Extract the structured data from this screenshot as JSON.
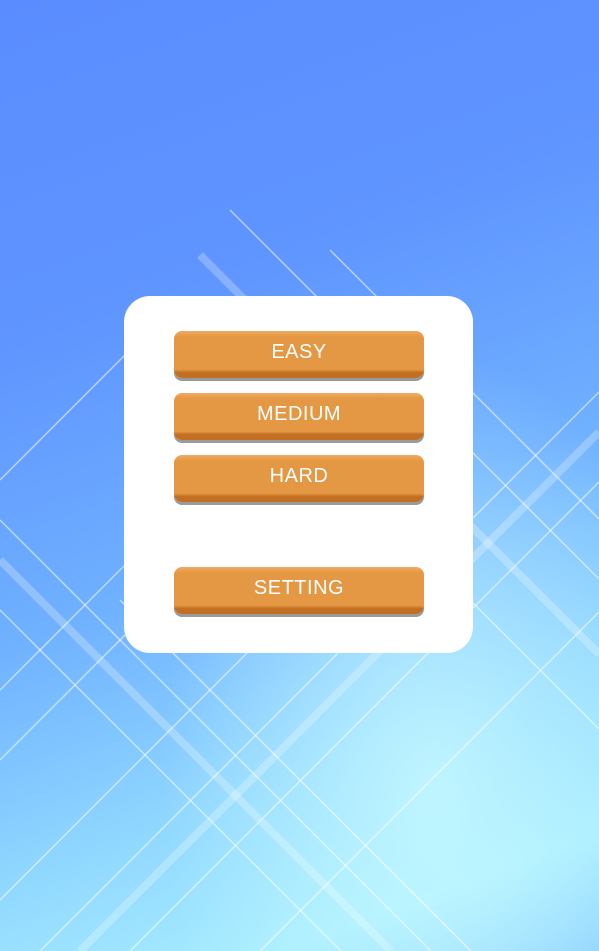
{
  "menu": {
    "easy_label": "EASY",
    "medium_label": "MEDIUM",
    "hard_label": "HARD",
    "setting_label": "SETTING"
  },
  "colors": {
    "background_top": "#5a8cff",
    "background_bottom": "#a6ecff",
    "card": "#ffffff",
    "button": "#e49843",
    "button_text": "#ffffff"
  }
}
